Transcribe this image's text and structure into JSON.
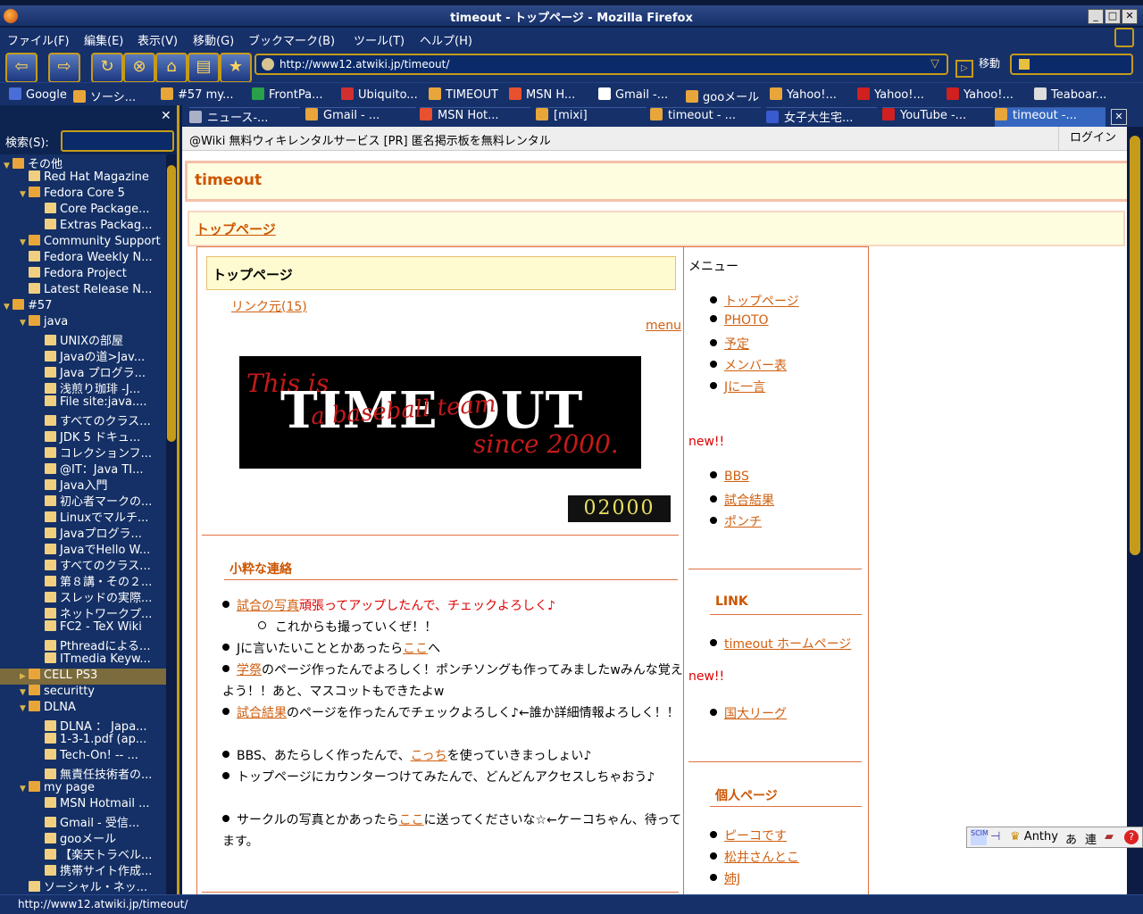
{
  "window": {
    "title": "timeout - トップページ - Mozilla Firefox"
  },
  "menu": [
    "ファイル(F)",
    "編集(E)",
    "表示(V)",
    "移動(G)",
    "ブックマーク(B)",
    "ツール(T)",
    "ヘルプ(H)"
  ],
  "nav": {
    "url": "http://www12.atwiki.jp/timeout/",
    "go_label": "移動"
  },
  "bookmarks": [
    "Google",
    "ソーシ...",
    "#57 my...",
    "FrontPa...",
    "Ubiquito...",
    "TIMEOUT",
    "MSN H...",
    "Gmail -...",
    "gooメール",
    "Yahoo!...",
    "Yahoo!...",
    "Yahoo!...",
    "Teaboar..."
  ],
  "sidebar": {
    "search_label": "検索(S):",
    "items": [
      {
        "label": "その他",
        "level": 0,
        "type": "folder"
      },
      {
        "label": "Red Hat Magazine",
        "level": 1,
        "type": "page"
      },
      {
        "label": "Fedora Core 5",
        "level": 1,
        "type": "folder"
      },
      {
        "label": "Core Package...",
        "level": 2,
        "type": "page"
      },
      {
        "label": "Extras Packag...",
        "level": 2,
        "type": "page"
      },
      {
        "label": "Community Support",
        "level": 1,
        "type": "folder"
      },
      {
        "label": "Fedora Weekly N...",
        "level": 1,
        "type": "page"
      },
      {
        "label": "Fedora Project",
        "level": 1,
        "type": "page"
      },
      {
        "label": "Latest Release N...",
        "level": 1,
        "type": "page"
      },
      {
        "label": "#57",
        "level": 0,
        "type": "folder"
      },
      {
        "label": "java",
        "level": 1,
        "type": "folder"
      },
      {
        "label": "UNIXの部屋",
        "level": 2,
        "type": "page"
      },
      {
        "label": "Javaの道>Jav...",
        "level": 2,
        "type": "page"
      },
      {
        "label": "Java プログラ...",
        "level": 2,
        "type": "page"
      },
      {
        "label": "浅煎り珈琲 -J...",
        "level": 2,
        "type": "page"
      },
      {
        "label": "File site:java....",
        "level": 2,
        "type": "page"
      },
      {
        "label": "すべてのクラス...",
        "level": 2,
        "type": "page"
      },
      {
        "label": "JDK 5 ドキュ...",
        "level": 2,
        "type": "page"
      },
      {
        "label": "コレクションフ...",
        "level": 2,
        "type": "page"
      },
      {
        "label": "@IT：Java TI...",
        "level": 2,
        "type": "page"
      },
      {
        "label": "Java入門",
        "level": 2,
        "type": "page"
      },
      {
        "label": "初心者マークの...",
        "level": 2,
        "type": "page"
      },
      {
        "label": "Linuxでマルチ...",
        "level": 2,
        "type": "page"
      },
      {
        "label": "Javaプログラ...",
        "level": 2,
        "type": "page"
      },
      {
        "label": "JavaでHello W...",
        "level": 2,
        "type": "page"
      },
      {
        "label": "すべてのクラス...",
        "level": 2,
        "type": "page"
      },
      {
        "label": "第８講・その２...",
        "level": 2,
        "type": "page"
      },
      {
        "label": "スレッドの実際...",
        "level": 2,
        "type": "page"
      },
      {
        "label": "ネットワークプ...",
        "level": 2,
        "type": "page"
      },
      {
        "label": "FC2 - TeX Wiki",
        "level": 2,
        "type": "page"
      },
      {
        "label": "Pthreadによる...",
        "level": 2,
        "type": "page"
      },
      {
        "label": "ITmedia Keyw...",
        "level": 2,
        "type": "page"
      },
      {
        "label": "CELL PS3",
        "level": 1,
        "type": "folder",
        "selected": true
      },
      {
        "label": "securitty",
        "level": 1,
        "type": "folder"
      },
      {
        "label": "DLNA",
        "level": 1,
        "type": "folder"
      },
      {
        "label": "DLNA ： Japa...",
        "level": 2,
        "type": "page"
      },
      {
        "label": "1-3-1.pdf (ap...",
        "level": 2,
        "type": "page"
      },
      {
        "label": "Tech-On! -- ...",
        "level": 2,
        "type": "page"
      },
      {
        "label": "無責任技術者の...",
        "level": 2,
        "type": "page"
      },
      {
        "label": "my page",
        "level": 1,
        "type": "folder"
      },
      {
        "label": "MSN Hotmail ...",
        "level": 2,
        "type": "page"
      },
      {
        "label": "Gmail - 受信...",
        "level": 2,
        "type": "page"
      },
      {
        "label": "gooメール",
        "level": 2,
        "type": "page"
      },
      {
        "label": "【楽天トラベル...",
        "level": 2,
        "type": "page"
      },
      {
        "label": "携帯サイト作成...",
        "level": 2,
        "type": "page"
      },
      {
        "label": "ソーシャル・ネッ...",
        "level": 1,
        "type": "page"
      }
    ]
  },
  "tabs": [
    {
      "label": "ニュース-..."
    },
    {
      "label": "Gmail - ..."
    },
    {
      "label": "MSN Hot..."
    },
    {
      "label": "[mixi]"
    },
    {
      "label": "timeout - ..."
    },
    {
      "label": "女子大生宅..."
    },
    {
      "label": "YouTube -..."
    },
    {
      "label": "timeout -...",
      "active": true
    }
  ],
  "page": {
    "wiki_bar": "@Wiki 無料ウィキレンタルサービス [PR] 匿名掲示板を無料レンタル",
    "login": "ログイン",
    "site_title": "timeout",
    "page_link": "トップページ",
    "content_title": "トップページ",
    "backlinks": "リンク元(15)",
    "menu_link": "menu",
    "banner_line1": "This is",
    "banner_line2": "TIME OUT",
    "banner_line3": "a baseball team",
    "banner_line4": "since 2000.",
    "counter": "02000",
    "news_heading": "小粋な連絡",
    "news": [
      {
        "link": "試合の写真",
        "text": "頑張ってアップしたんで、チェックよろしく♪"
      },
      {
        "text": "これからも撮っていくぜ！！"
      },
      {
        "pre": "Jに言いたいこととかあったら",
        "link": "ここ",
        "post": "へ"
      },
      {
        "link": "学祭",
        "text": "のページ作ったんでよろしく！ポンチソングも作ってみましたwみんな覚えよう！！あと、マスコットもできたよw"
      },
      {
        "link": "試合結果",
        "text": "のページを作ったんでチェックよろしく♪←誰か詳細情報よろしく！！"
      },
      {
        "pre": "BBS、あたらしく作ったんで、",
        "link": "こっち",
        "post": "を使っていきまっしょい♪"
      },
      {
        "text": "トップページにカウンターつけてみたんで、どんどんアクセスしちゃおう♪"
      },
      {
        "pre": "サークルの写真とかあったら",
        "link": "ここ",
        "post": "に送ってくださいな☆←ケーコちゃん、待ってます。"
      }
    ],
    "side_menu_title": "メニュー",
    "side_menu": [
      "トップページ",
      "PHOTO",
      "予定",
      "メンバー表",
      "Jに一言"
    ],
    "new1": "new!!",
    "side_new": [
      "BBS",
      "試合結果",
      "ポンチ"
    ],
    "link_heading": "LINK",
    "link_items": [
      "timeout ホームページ"
    ],
    "new2": "new!!",
    "league": [
      "国大リーグ"
    ],
    "personal_heading": "個人ページ",
    "personal": [
      "ピーコです",
      "松井さんとこ",
      "姉J"
    ]
  },
  "status": {
    "text": "http://www12.atwiki.jp/timeout/"
  },
  "ime": {
    "label": "Anthy",
    "mode1": "あ",
    "mode2": "連"
  }
}
